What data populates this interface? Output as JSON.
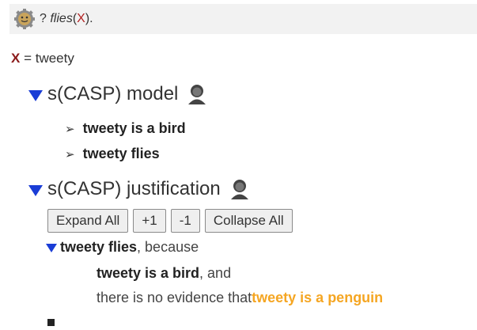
{
  "query": {
    "prompt": "?",
    "predicate": "flies",
    "open_paren": "(",
    "variable": "X",
    "close": ")."
  },
  "binding": {
    "variable": "X",
    "equals": " = ",
    "value": "tweety"
  },
  "model": {
    "title": "s(CASP) model",
    "items": [
      "tweety is a bird",
      "tweety flies"
    ]
  },
  "justification": {
    "title": "s(CASP) justification",
    "buttons": {
      "expand_all": "Expand All",
      "plus_one": "+1",
      "minus_one": "-1",
      "collapse_all": "Collapse All"
    },
    "root": {
      "fact": "tweety flies",
      "connector": ", because"
    },
    "children": [
      {
        "fact": "tweety is a bird",
        "connector": ", and"
      },
      {
        "prefix": "there is no evidence that ",
        "fact": "tweety is a penguin"
      }
    ]
  },
  "colors": {
    "accent_triangle": "#1a3dd6",
    "variable": "#8b1a1a",
    "highlight": "#f5a623"
  },
  "icons": {
    "query": "gear-icon",
    "section": "person-icon",
    "bullet": "arrowhead-icon"
  }
}
